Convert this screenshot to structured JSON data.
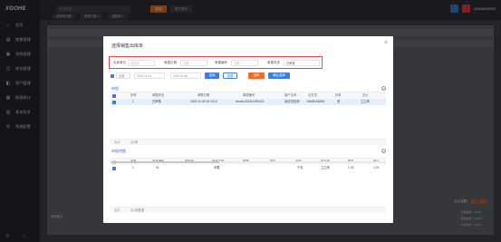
{
  "app": {
    "brand": "XGOHE",
    "phone": "15468116265"
  },
  "sidebar": {
    "items": [
      {
        "label": "首页",
        "icon": "home-icon"
      },
      {
        "label": "销售管理",
        "icon": "sales-icon"
      },
      {
        "label": "采购管理",
        "icon": "purchase-icon"
      },
      {
        "label": "库存管理",
        "icon": "stock-icon"
      },
      {
        "label": "资产管理",
        "icon": "asset-icon"
      },
      {
        "label": "报表统计",
        "icon": "report-icon"
      },
      {
        "label": "基本信息",
        "icon": "info-icon"
      },
      {
        "label": "系统配置",
        "icon": "settings-icon"
      }
    ]
  },
  "topbar": {
    "search_text": "全局搜索",
    "tabs": [
      "销售单列表",
      "采购订单 ×",
      "销售单 ×"
    ],
    "orange_btn": "新增",
    "gray_btn": "更多操作"
  },
  "background": {
    "total_label": "合计金额：",
    "total_value": "¥0.00",
    "lines": [
      "优惠金额：¥0.00",
      "实收金额：¥0.00",
      "本次欠款：¥0.00"
    ],
    "bottom_label": "销售备注"
  },
  "modal": {
    "title": "选择销售出库单",
    "close": "×",
    "filters": [
      {
        "label": "出库单位",
        "placeholder": "请选择"
      },
      {
        "label": "单据日期",
        "placeholder": "请输入"
      },
      {
        "label": "单据编号",
        "placeholder": "请输入"
      },
      {
        "label": "单据状态",
        "value": "已审核"
      }
    ],
    "date_type": "全部",
    "date_from": "2023-11-01",
    "date_sep": "~",
    "date_to": "2023-11-30",
    "buttons": {
      "query": "查询",
      "reset": "重置",
      "select": "选择",
      "confirm": "确认选择"
    },
    "section1": {
      "title": "单据",
      "columns": [
        "序号",
        "单据状态",
        "单据日期",
        "单据编号",
        "客户名称",
        "业务员",
        "折单",
        "总价"
      ],
      "rows": [
        [
          "1",
          "已审核",
          "2023-11-08 10:15:11",
          "xssdd-202311080004",
          "测试供应商",
          "15468116265",
          "是",
          "立立商"
        ]
      ],
      "footer": [
        "合计",
        "共1条"
      ]
    },
    "section2": {
      "title": "单据明细",
      "columns": [
        "序号",
        "商品编码",
        "条形码",
        "商品名称",
        "规格",
        "单位",
        "仓库",
        "批次号",
        "数量",
        "单价"
      ],
      "rows": [
        [
          "1",
          "01",
          "",
          "苹果",
          "",
          "",
          "千克",
          "立立商",
          "1.00",
          "1.00"
        ]
      ],
      "footer": [
        "合计",
        "共1条数据"
      ]
    }
  },
  "colors": {
    "accent": "#3d7edb",
    "orange": "#ef6b26",
    "highlight": "#e0474b"
  }
}
